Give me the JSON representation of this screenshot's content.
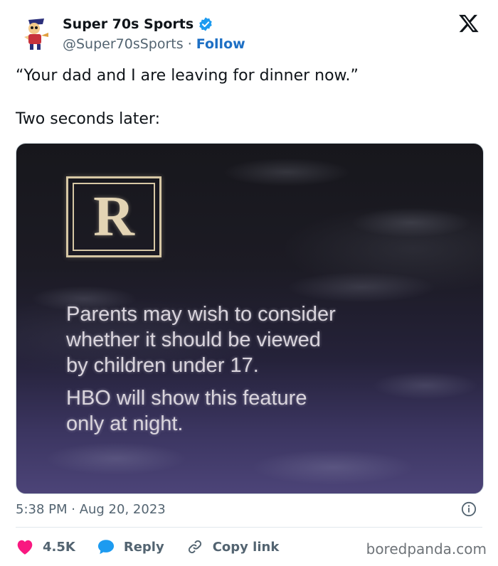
{
  "author": {
    "display_name": "Super 70s Sports",
    "handle": "@Super70sSports",
    "separator": " · ",
    "follow_label": "Follow",
    "avatar_icon": "cartoon-mascot-avatar",
    "verified_icon": "verified-badge-icon",
    "verified_color": "#1d9bf0"
  },
  "brand": {
    "icon": "x-logo-icon"
  },
  "tweet": {
    "line1": "“Your dad and I are leaving for dinner now.”",
    "line2": "Two seconds later:"
  },
  "media": {
    "rating_letter": "R",
    "notice_line1": "Parents may wish to consider",
    "notice_line2": "whether it should be viewed",
    "notice_line3": "by children under 17.",
    "notice_line4": "HBO will show this feature",
    "notice_line5": "only at night."
  },
  "meta": {
    "timestamp": "5:38 PM · Aug 20, 2023",
    "info_icon": "info-icon"
  },
  "actions": {
    "like_count": "4.5K",
    "like_color": "#f91880",
    "reply_label": "Reply",
    "reply_color": "#1d9bf0",
    "copy_link_label": "Copy link"
  },
  "watermark": "boredpanda.com"
}
